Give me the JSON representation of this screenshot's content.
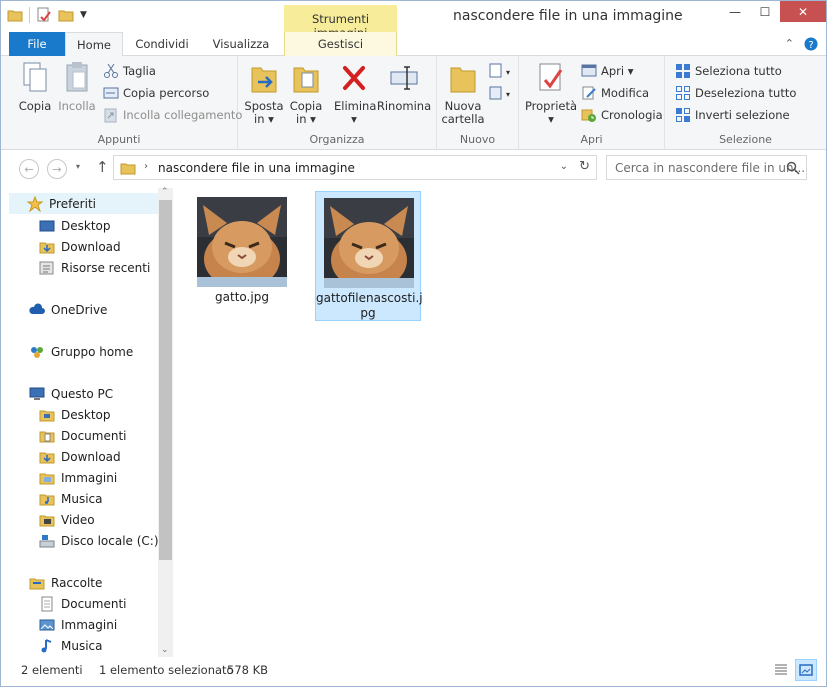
{
  "window": {
    "title": "nascondere file in una immagine",
    "context_tab": "Strumenti immagini",
    "controls": {
      "minimize": "—",
      "maximize": "☐",
      "close": "✕"
    }
  },
  "tabs": [
    {
      "label": "File"
    },
    {
      "label": "Home"
    },
    {
      "label": "Condividi"
    },
    {
      "label": "Visualizza"
    },
    {
      "label": "Gestisci"
    }
  ],
  "ribbon": {
    "appunti": {
      "label": "Appunti",
      "copia": "Copia",
      "incolla": "Incolla",
      "taglia": "Taglia",
      "copia_percorso": "Copia percorso",
      "incolla_collegamento": "Incolla collegamento"
    },
    "organizza": {
      "label": "Organizza",
      "sposta_in": "Sposta",
      "sposta_in_2": "in ▾",
      "copia_in": "Copia",
      "copia_in_2": "in ▾",
      "elimina": "Elimina",
      "elimina_2": "▾",
      "rinomina": "Rinomina"
    },
    "nuovo": {
      "label": "Nuovo",
      "nuova_cartella": "Nuova",
      "nuova_cartella_2": "cartella"
    },
    "apri": {
      "label": "Apri",
      "proprieta": "Proprietà",
      "proprieta_2": "▾",
      "apri": "Apri ▾",
      "modifica": "Modifica",
      "cronologia": "Cronologia"
    },
    "selezione": {
      "label": "Selezione",
      "seleziona_tutto": "Seleziona tutto",
      "deseleziona_tutto": "Deseleziona tutto",
      "inverti_selezione": "Inverti selezione"
    }
  },
  "address": {
    "path": "nascondere file in una immagine",
    "search_placeholder": "Cerca in nascondere file in un..."
  },
  "nav": {
    "preferiti": "Preferiti",
    "desktop": "Desktop",
    "download": "Download",
    "risorse_recenti": "Risorse recenti",
    "onedrive": "OneDrive",
    "gruppo_home": "Gruppo home",
    "questo_pc": "Questo PC",
    "pc_desktop": "Desktop",
    "pc_documenti": "Documenti",
    "pc_download": "Download",
    "pc_immagini": "Immagini",
    "pc_musica": "Musica",
    "pc_video": "Video",
    "pc_disco": "Disco locale (C:)",
    "raccolte": "Raccolte",
    "r_documenti": "Documenti",
    "r_immagini": "Immagini",
    "r_musica": "Musica"
  },
  "files": [
    {
      "name": "gatto.jpg",
      "selected": false
    },
    {
      "name_line1": "gattofilenascosti.j",
      "name_line2": "pg",
      "selected": true
    }
  ],
  "status": {
    "count": "2 elementi",
    "selection": "1 elemento selezionato",
    "size": "578 KB"
  },
  "colors": {
    "accent": "#1979ca",
    "selection": "#cce8ff",
    "context_tab": "#f6ec9a"
  }
}
